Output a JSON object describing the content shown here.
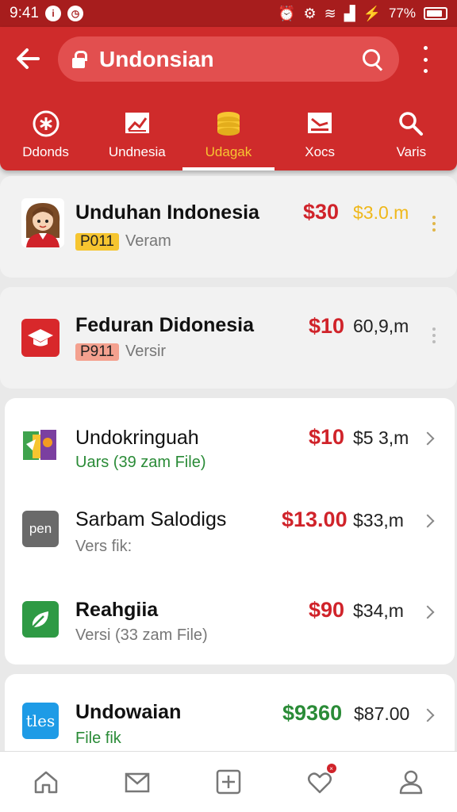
{
  "status_bar": {
    "time": "9:41",
    "battery": "77%"
  },
  "header": {
    "search": {
      "value": "Undonsian"
    },
    "tabs": [
      {
        "label": "Ddonds",
        "icon": "asterisk-circle-icon",
        "active": false
      },
      {
        "label": "Undnesia",
        "icon": "chart-icon",
        "active": false
      },
      {
        "label": "Udagak",
        "icon": "coin-stack-icon",
        "active": true
      },
      {
        "label": "Xocs",
        "icon": "chart-down-icon",
        "active": false
      },
      {
        "label": "Varis",
        "icon": "search-icon",
        "active": false
      }
    ]
  },
  "items": [
    {
      "title": "Unduhan Indonesia",
      "badge": "P011",
      "subtitle": "Veram",
      "price": "$30",
      "size": "$3.0.m",
      "icon": "avatar-girl-icon"
    },
    {
      "title": "Feduran Didonesia",
      "badge": "P911",
      "subtitle": "Versir",
      "price": "$10",
      "size": "60,9,m",
      "icon": "graduation-cap-icon"
    },
    {
      "title": "Undokringuah",
      "subtitle": "Uars (39 zam File)",
      "price": "$10",
      "size": "$5 3,m",
      "icon": "colorful-app-icon"
    },
    {
      "title": "Sarbam Salodigs",
      "subtitle": "Vers fik:",
      "price": "$13.00",
      "size": "$33,m",
      "icon_text": "pen",
      "icon": "pen-app-icon"
    },
    {
      "title": "Reahgiia",
      "subtitle": "Versi (33 zam File)",
      "price": "$90",
      "size": "$34,m",
      "icon": "leaf-app-icon"
    },
    {
      "title": "Undowaian",
      "subtitle": "File fik",
      "price": "$9360",
      "size": "$87.00",
      "icon_text": "tles",
      "icon": "tles-app-icon"
    }
  ],
  "bottom_nav": [
    {
      "icon": "home-icon"
    },
    {
      "icon": "mail-icon"
    },
    {
      "icon": "add-icon"
    },
    {
      "icon": "heart-icon",
      "badge": "×"
    },
    {
      "icon": "profile-icon"
    }
  ],
  "colors": {
    "primary": "#cf2b2b",
    "status_bar": "#a71d1d",
    "accent": "#f7c531",
    "price_red": "#d0232a",
    "price_green": "#2a8b37"
  }
}
